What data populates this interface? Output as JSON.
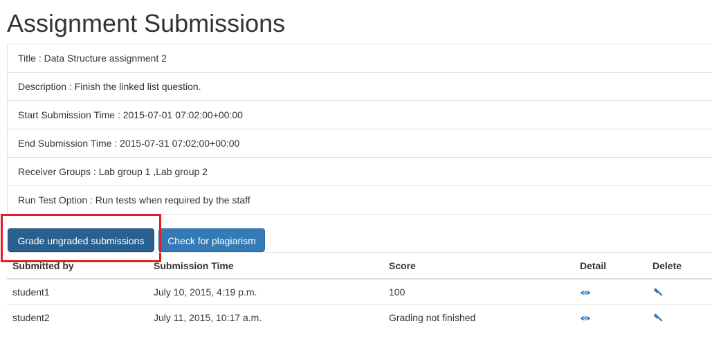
{
  "page": {
    "title": "Assignment Submissions"
  },
  "info": [
    {
      "text": "Title : Data Structure assignment 2"
    },
    {
      "text": "Description : Finish the linked list question."
    },
    {
      "text": "Start Submission Time : 2015-07-01 07:02:00+00:00"
    },
    {
      "text": "End Submission Time : 2015-07-31 07:02:00+00:00"
    },
    {
      "text": "Receiver Groups : Lab group 1 ,Lab group 2"
    },
    {
      "text": "Run Test Option : Run tests when required by the staff"
    }
  ],
  "actions": {
    "grade_label": "Grade ungraded submissions",
    "plagiarism_label": "Check for plagiarism"
  },
  "table": {
    "headers": {
      "submitted_by": "Submitted by",
      "submission_time": "Submission Time",
      "score": "Score",
      "detail": "Detail",
      "delete": "Delete"
    },
    "rows": [
      {
        "user": "student1",
        "time": "July 10, 2015, 4:19 p.m.",
        "score": "100",
        "detail_icon": "eye-icon",
        "delete_icon": "gavel-icon"
      },
      {
        "user": "student2",
        "time": "July 11, 2015, 10:17 a.m.",
        "score": "Grading not finished",
        "detail_icon": "eye-icon",
        "delete_icon": "gavel-icon"
      }
    ]
  },
  "colors": {
    "primary": "#337ab7",
    "primary_active": "#286090",
    "highlight": "#e01e26",
    "border": "#dddddd"
  }
}
